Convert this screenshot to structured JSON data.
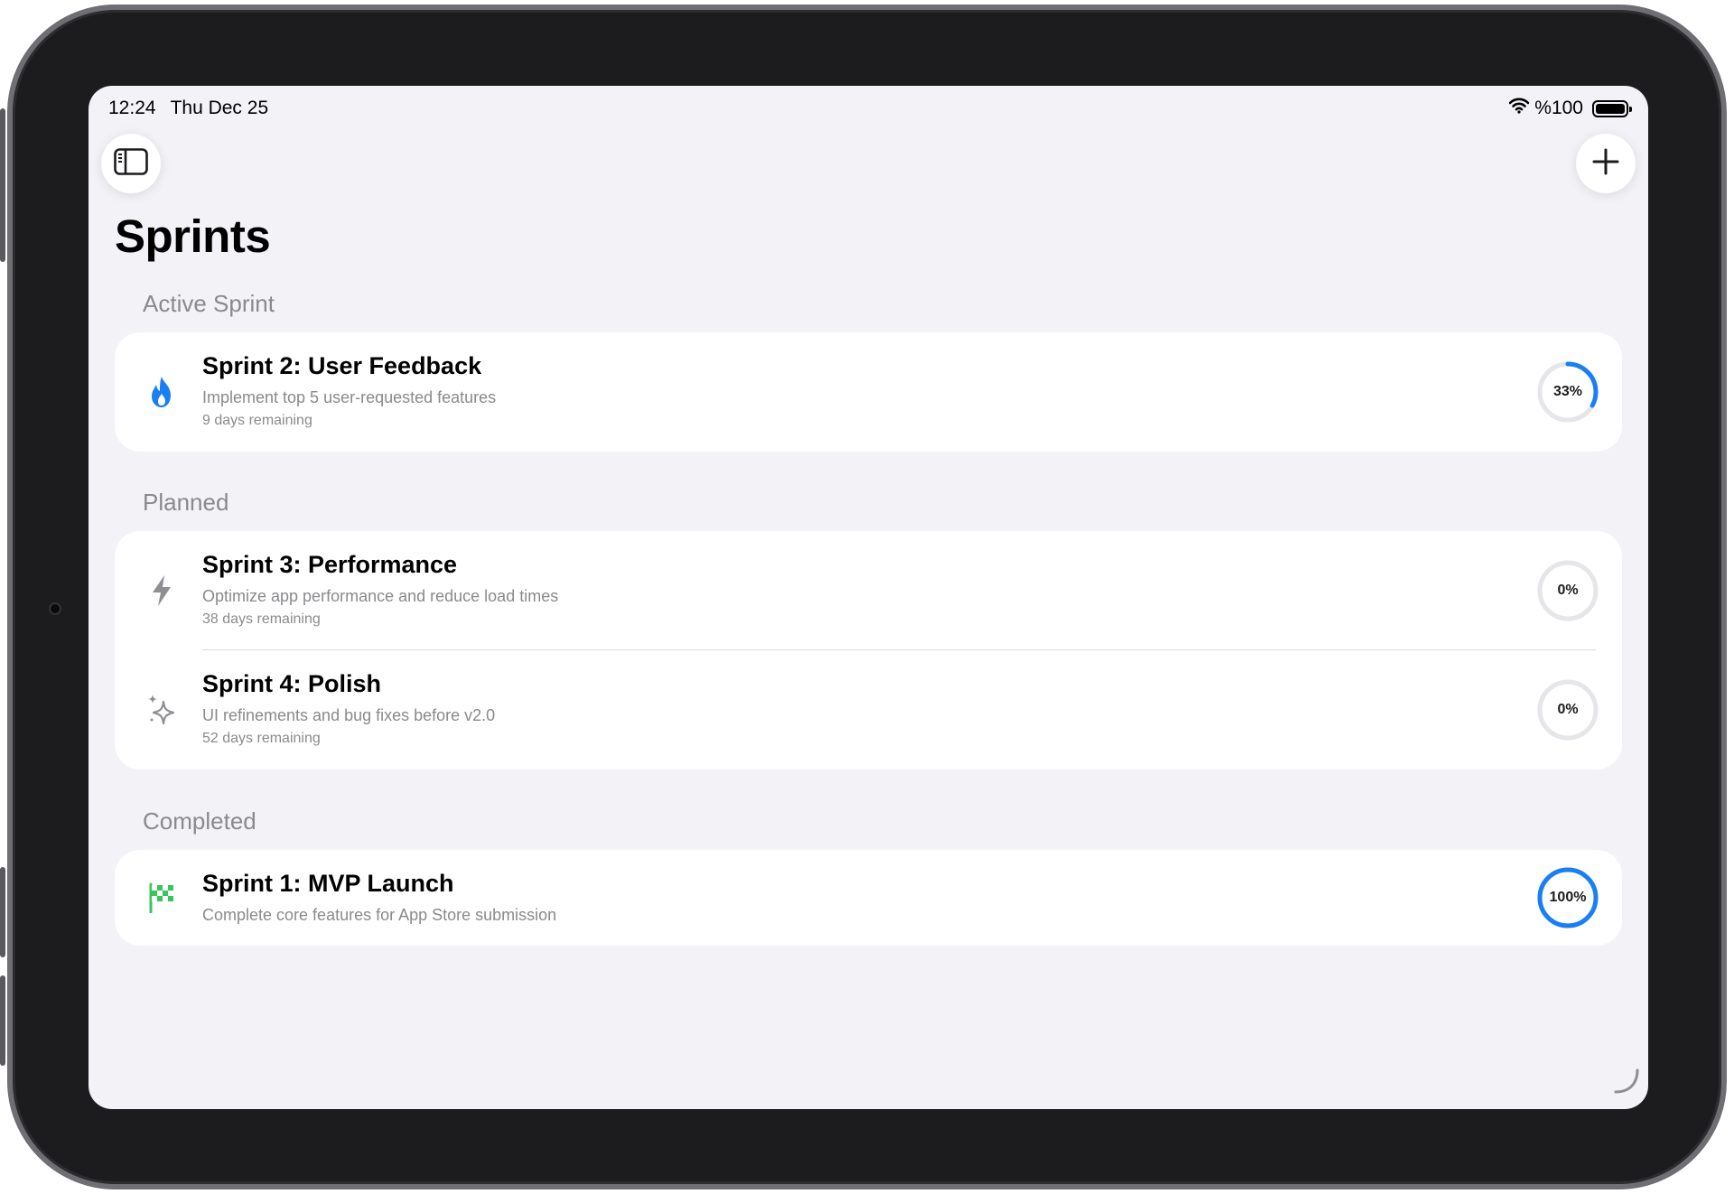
{
  "status_bar": {
    "time": "12:24",
    "date": "Thu Dec 25",
    "battery": "%100"
  },
  "page_title": "Sprints",
  "sections": {
    "active": {
      "header": "Active Sprint",
      "sprints": [
        {
          "title": "Sprint 2: User Feedback",
          "description": "Implement top 5 user-requested features",
          "remaining": "9 days remaining",
          "progress_label": "33%",
          "progress": 0.33,
          "icon": "flame-icon",
          "icon_color": "#1a7ff5"
        }
      ]
    },
    "planned": {
      "header": "Planned",
      "sprints": [
        {
          "title": "Sprint 3: Performance",
          "description": "Optimize app performance and reduce load times",
          "remaining": "38 days remaining",
          "progress_label": "0%",
          "progress": 0,
          "icon": "bolt-icon",
          "icon_color": "#8e8e93"
        },
        {
          "title": "Sprint 4: Polish",
          "description": "UI refinements and bug fixes before v2.0",
          "remaining": "52 days remaining",
          "progress_label": "0%",
          "progress": 0,
          "icon": "sparkles-icon",
          "icon_color": "#8e8e93"
        }
      ]
    },
    "completed": {
      "header": "Completed",
      "sprints": [
        {
          "title": "Sprint 1: MVP Launch",
          "description": "Complete core features for App Store submission",
          "progress_label": "100%",
          "progress": 1.0,
          "icon": "checkered-flag-icon",
          "icon_color": "#34c759"
        }
      ]
    }
  },
  "colors": {
    "accent": "#1a7ff5",
    "track": "#e5e5ea",
    "background": "#f2f2f7"
  }
}
